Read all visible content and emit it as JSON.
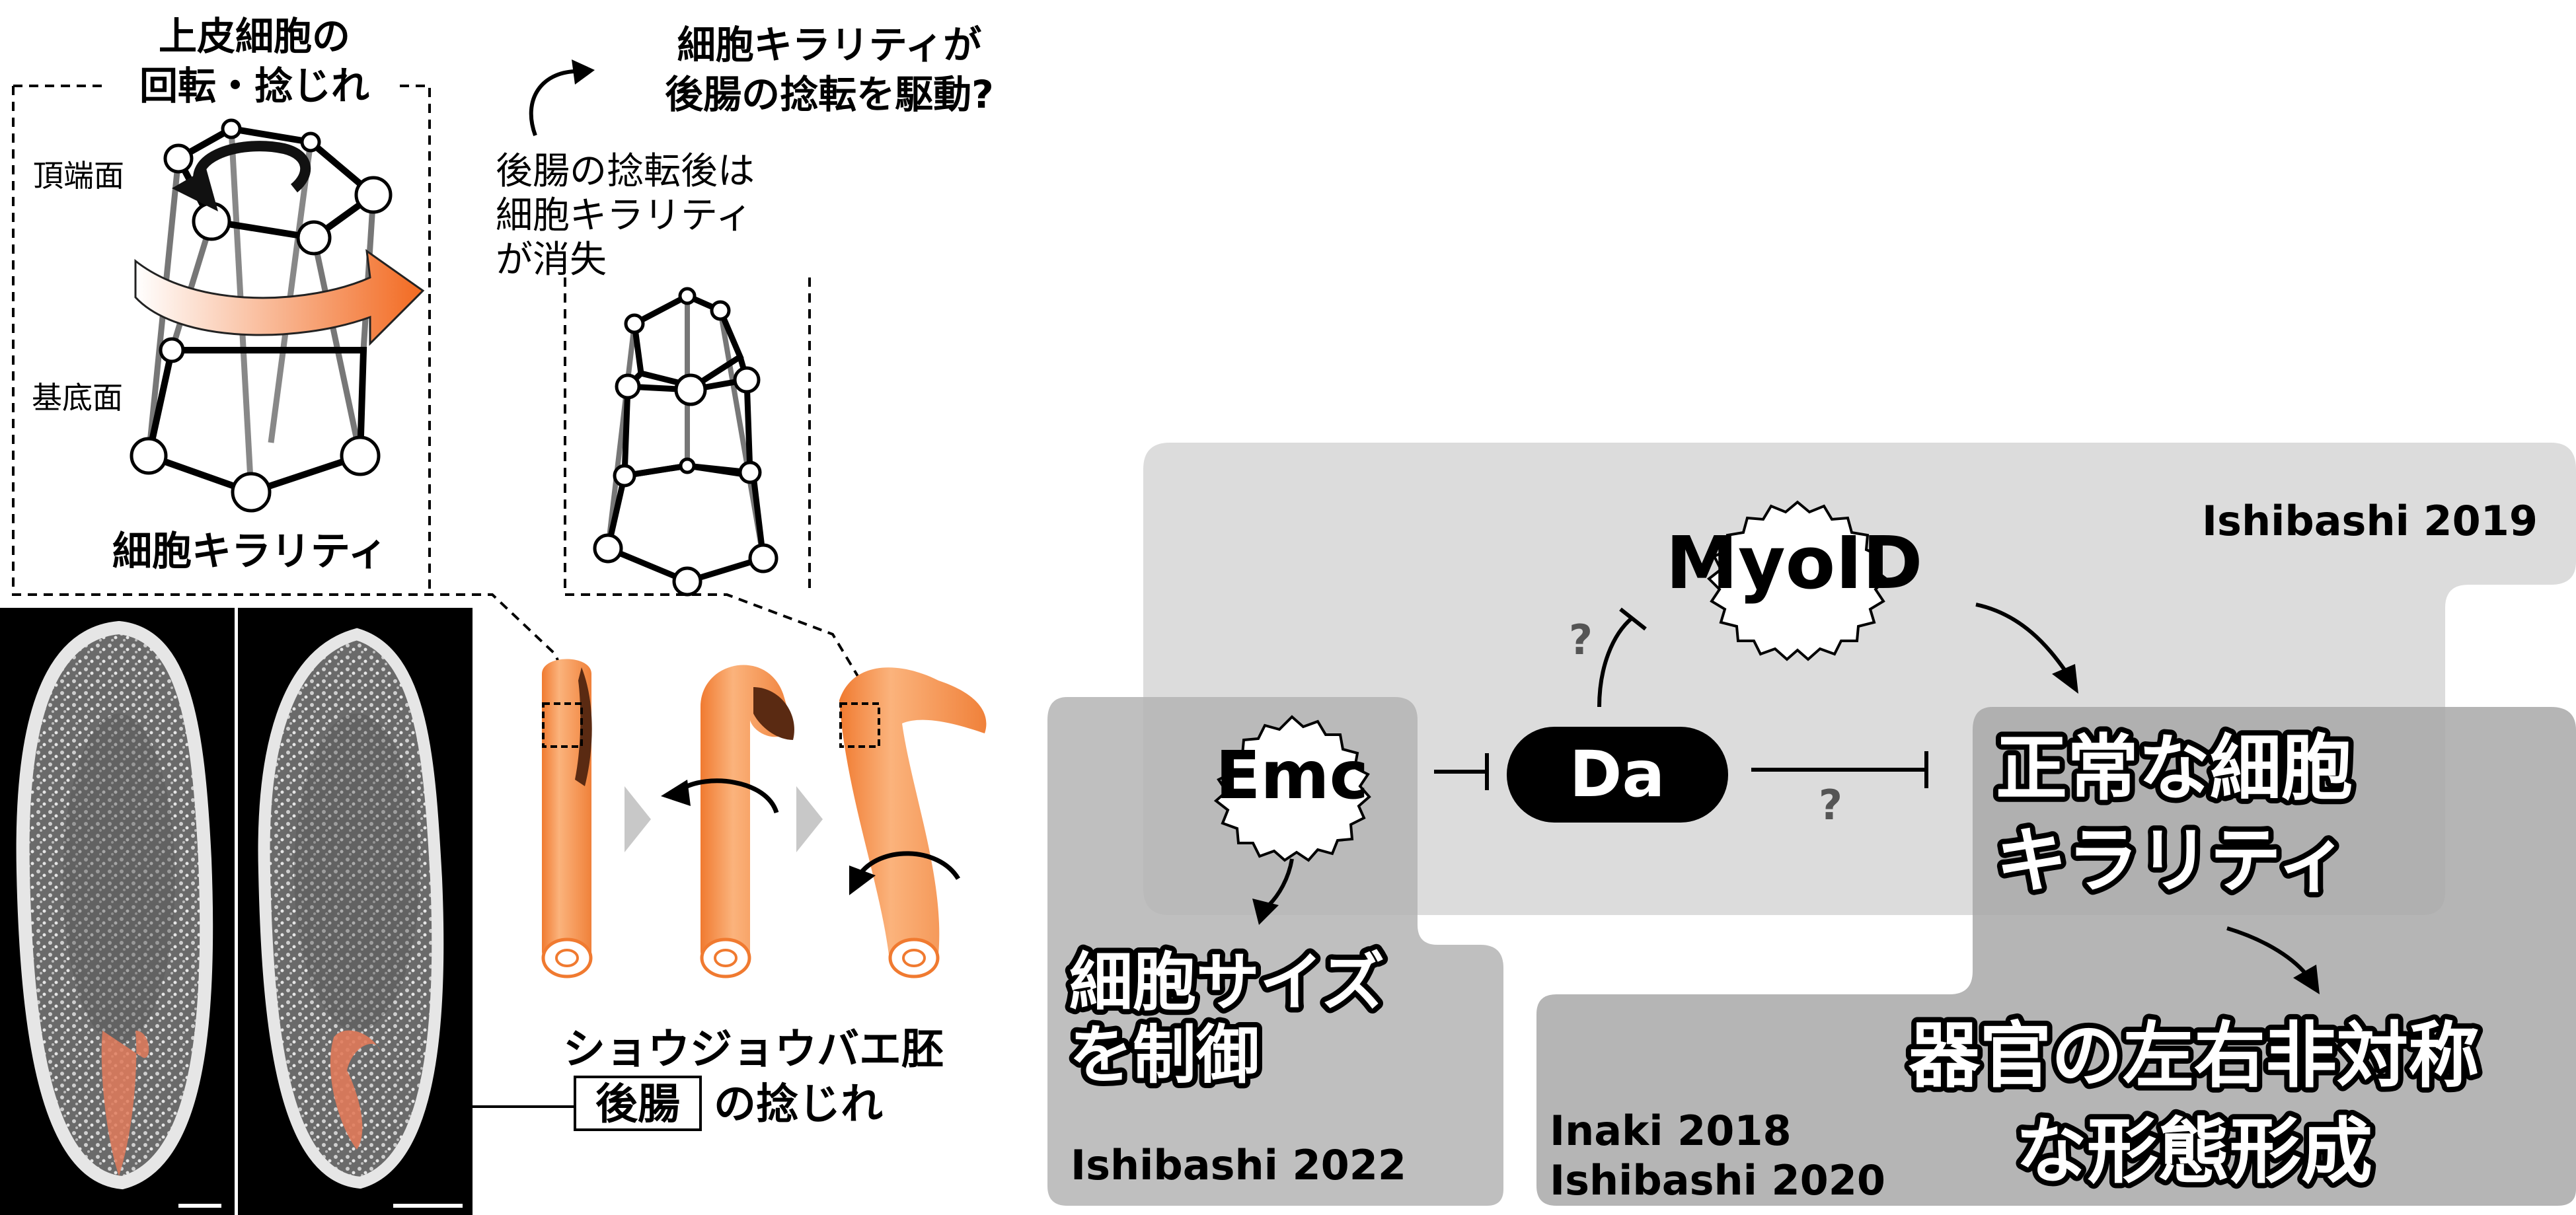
{
  "left_panel": {
    "rotation_title": [
      "上皮細胞の",
      "回転・捻じれ"
    ],
    "apical_label": "頂端面",
    "basal_label": "基底面",
    "chirality_label": "細胞キラリティ",
    "question_title": [
      "細胞キラリティが",
      "後腸の捻転を駆動?"
    ],
    "loss_note": [
      "後腸の捻転後は",
      "細胞キラリティ",
      "が消失"
    ],
    "embryo_caption_line1": "ショウジョウバエ胚",
    "embryo_caption_boxed": "後腸",
    "embryo_caption_rest": "の捻じれ"
  },
  "right_panel": {
    "myo_label": "MyoID",
    "emc_label": "Emc",
    "da_label": "Da",
    "question_mark_1": "?",
    "question_mark_2": "?",
    "normal_chirality": [
      "正常な細胞",
      "キラリティ"
    ],
    "cell_size": [
      "細胞サイズ",
      "を制御"
    ],
    "organ_asymmetry": [
      "器官の左右非対称",
      "な形態形成"
    ],
    "ref_ishibashi_2019": "Ishibashi 2019",
    "ref_ishibashi_2022": "Ishibashi 2022",
    "ref_inaki_2018": "Inaki 2018",
    "ref_ishibashi_2020": "Ishibashi 2020"
  },
  "colors": {
    "gut_orange": "#f79a50",
    "gut_dark": "#5a2a12",
    "box_light": "#dcdcdc",
    "box_mid": "#b4b4b4",
    "box_dark": "#a8a8a8",
    "hindgut_stain": "#e07a5a"
  }
}
